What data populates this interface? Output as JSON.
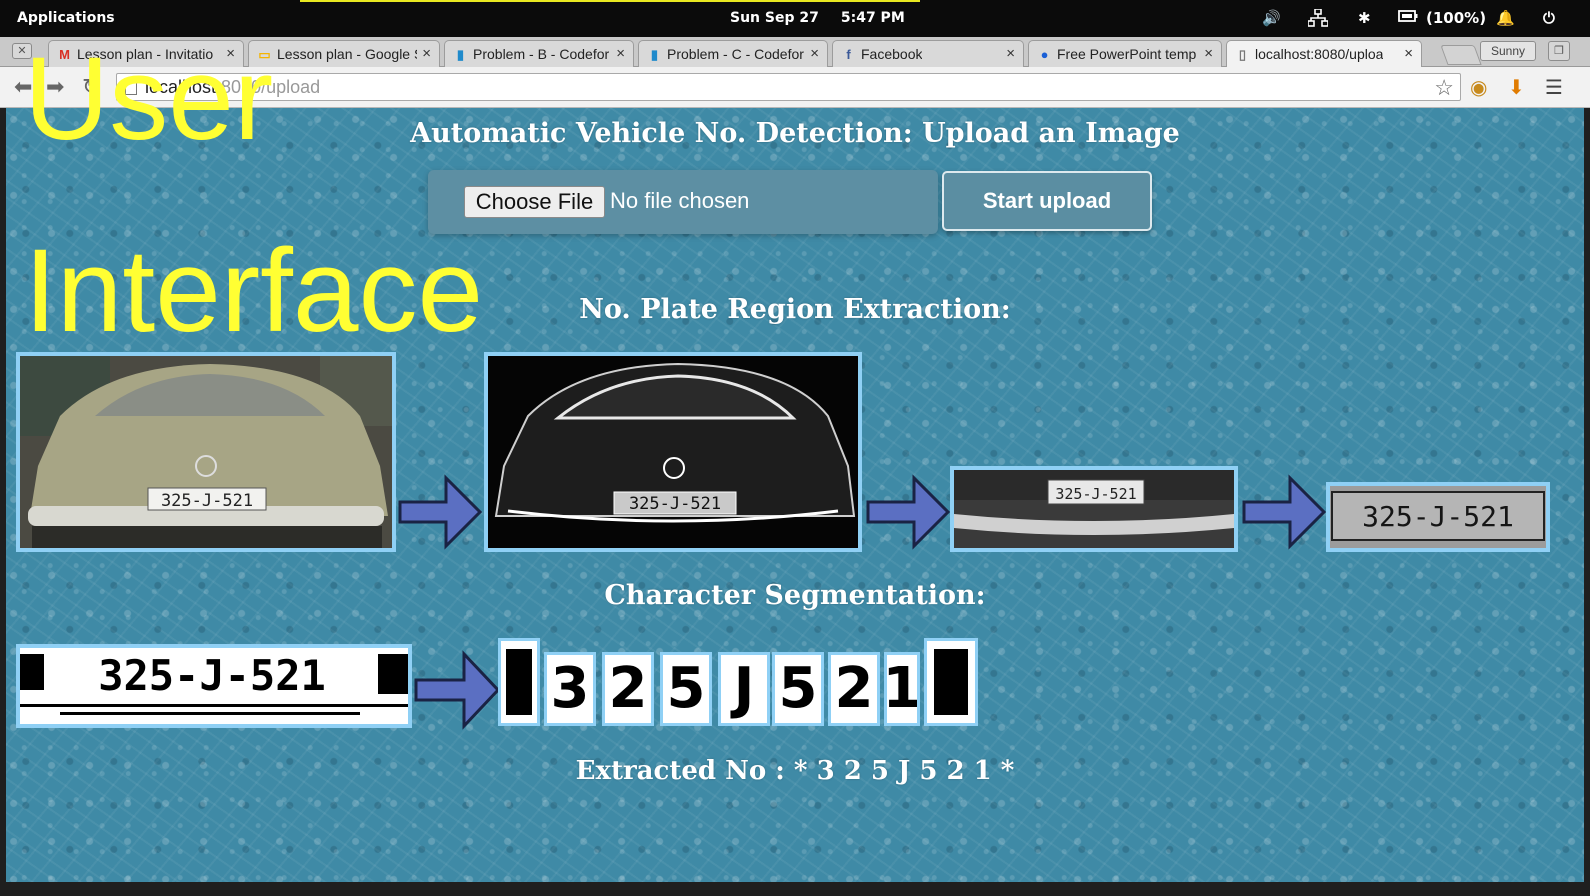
{
  "system_bar": {
    "apps_label": "Applications",
    "date": "Sun Sep 27",
    "time": "5:47 PM",
    "battery": "(100%)"
  },
  "tabs": [
    {
      "title": "Lesson plan - Invitatio",
      "icon": "gmail-icon",
      "icon_glyph": "M",
      "icon_color": "#d93025"
    },
    {
      "title": "Lesson plan - Google S",
      "icon": "slides-icon",
      "icon_glyph": "▭",
      "icon_color": "#f4b400"
    },
    {
      "title": "Problem - B - Codefor",
      "icon": "codeforces-icon",
      "icon_glyph": "▮",
      "icon_color": "#1f8acb"
    },
    {
      "title": "Problem - C - Codefor",
      "icon": "codeforces-icon",
      "icon_glyph": "▮",
      "icon_color": "#1f8acb"
    },
    {
      "title": "Facebook",
      "icon": "facebook-icon",
      "icon_glyph": "f",
      "icon_color": "#3b5998"
    },
    {
      "title": "Free PowerPoint temp",
      "icon": "powerpoint-site-icon",
      "icon_glyph": "●",
      "icon_color": "#1a5fd6"
    },
    {
      "title": "localhost:8080/uploa",
      "icon": "page-icon",
      "icon_glyph": "▯",
      "icon_color": "#777777",
      "active": true
    }
  ],
  "profile_name": "Sunny",
  "url": {
    "host": "localhost",
    "path": ":8080/upload"
  },
  "page": {
    "title": "Automatic Vehicle No. Detection: Upload an Image",
    "choose_file_label": "Choose File",
    "file_status": "No file chosen",
    "upload_button": "Start upload",
    "section_plate": "No. Plate Region Extraction:",
    "section_segmentation": "Character Segmentation:",
    "extracted_text": "Extracted No : * 3 2 5 J 5 2 1 *"
  },
  "plate_number": "325-J-521",
  "segmented_chars": [
    "3",
    "2",
    "5",
    "J",
    "5",
    "2",
    "1"
  ],
  "overlay": {
    "line1": "User",
    "line2": "Interface",
    "color": "#ffff33"
  },
  "colors": {
    "page_bg": "#3f8aa6",
    "image_border": "#8fd0f5",
    "arrow_fill": "#5b6fc2"
  }
}
